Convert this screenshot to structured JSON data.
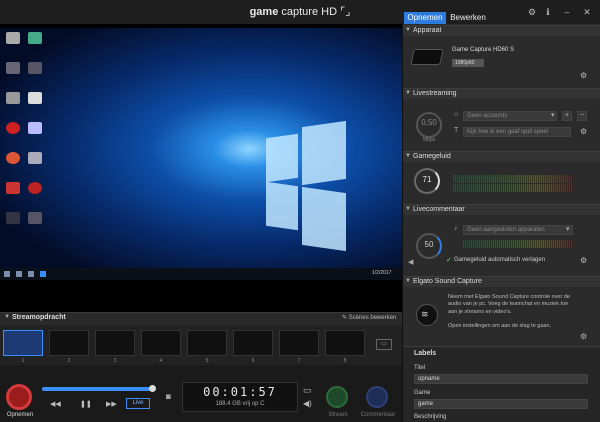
{
  "app": {
    "title_bold": "game",
    "title_rest": "capture HD"
  },
  "titlebar": {
    "gear": "⚙",
    "info": "ℹ",
    "minimize": "–",
    "close": "✕"
  },
  "tabs": [
    {
      "label": "Opnemen",
      "active": true
    },
    {
      "label": "Bewerken",
      "active": false
    }
  ],
  "stream": {
    "title": "Streamopdracht",
    "edit_label": "Scènes bewerken",
    "scenes": [
      "1",
      "2",
      "3",
      "4",
      "5",
      "6",
      "7",
      "8"
    ]
  },
  "controls": {
    "record_label": "Opnemen",
    "rewind": "◀◀",
    "pause": "❚❚",
    "forward": "▶▶",
    "live_label": "Live",
    "time": "00:01:57",
    "disk": "188.4 GB vrij op C",
    "stream_label": "Stream",
    "comment_label": "Commentaar",
    "scrub_progress": 0.98
  },
  "desktop": {
    "clock": "1/2/2017"
  },
  "sections": {
    "device": {
      "title": "Apparaat",
      "name": "Game Capture HD60 S",
      "badge": "1080p60"
    },
    "livestream": {
      "title": "Livestreaming",
      "mbps_value": "0,50",
      "mbps_unit": "Mbps",
      "accounts": "Geen accounts",
      "title_placeholder": "Kijk hoe ik een gaaf spel speel"
    },
    "gamesound": {
      "title": "Gamegeluid",
      "value": "71"
    },
    "commentary": {
      "title": "Livecommentaar",
      "value": "50",
      "device": "Geen aangesloten apparaten",
      "check_label": "Gamegeluid automatisch verlagen"
    },
    "sound_capture": {
      "title": "Elgato Sound Capture",
      "text": "Neem met Elgato Sound Capture controle over de audio van je pc. Voeg de teamchat en muziek toe aan je streams en video's.",
      "text2": "Open instellingen om aan de slag te gaan."
    },
    "labels": {
      "title": "Labels",
      "title_label": "Titel",
      "title_value": "opname",
      "game_label": "Game",
      "game_value": "game",
      "description_label": "Beschrijving"
    }
  }
}
